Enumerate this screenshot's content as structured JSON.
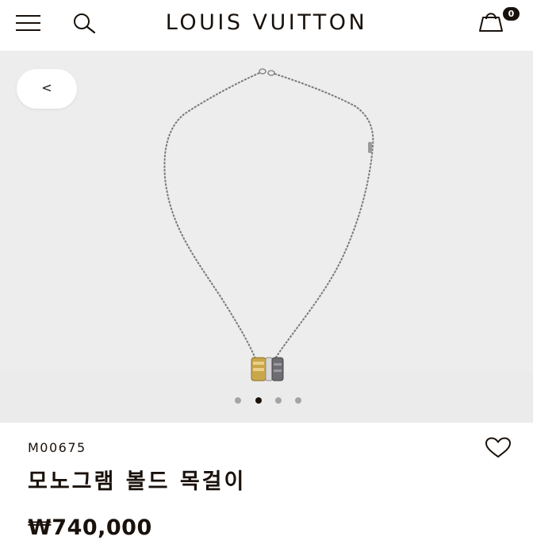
{
  "header": {
    "logo_text": "LOUIS VUITTON",
    "menu_icon": "hamburger-menu-icon",
    "search_icon": "search-icon",
    "bag_icon": "shopping-bag-icon",
    "cart_count": "0"
  },
  "gallery": {
    "back_label": "<",
    "image": "necklace-image",
    "dots_total": 4,
    "active_index": 1,
    "background": "#ededed"
  },
  "product": {
    "sku": "M00675",
    "name": "모노그램 볼드 목걸이",
    "price": "₩740,000",
    "wishlist_icon": "heart-icon"
  },
  "colors": {
    "text": "#19110b",
    "gallery_bg": "#ededed",
    "dot_inactive": "#a4a4a4",
    "dot_active": "#19110b"
  }
}
